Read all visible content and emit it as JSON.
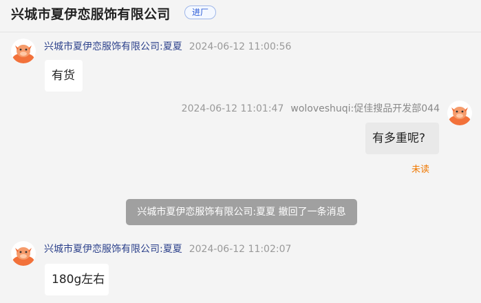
{
  "header": {
    "title": "兴城市夏伊恋服饰有限公司",
    "tag_label": "进厂"
  },
  "messages": [
    {
      "sender": "兴城市夏伊恋服饰有限公司:夏夏",
      "time": "2024-06-12 11:00:56",
      "text": "有货",
      "side": "left"
    },
    {
      "sender": "woloveshuqi:促佳搜品开发部044",
      "time": "2024-06-12 11:01:47",
      "text": "有多重呢?",
      "side": "right",
      "status": "未读"
    },
    {
      "sender": "兴城市夏伊恋服饰有限公司:夏夏",
      "time": "2024-06-12 11:02:07",
      "text": "180g左右",
      "side": "left"
    }
  ],
  "system_notice": "兴城市夏伊恋服饰有限公司:夏夏 撤回了一条消息",
  "colors": {
    "avatar_bg": "#ffffff",
    "avatar_orange": "#f2713a",
    "unread": "#f07800",
    "sender_link": "#2a3f8a"
  },
  "icons": {
    "avatar": "cow-avatar-icon"
  }
}
